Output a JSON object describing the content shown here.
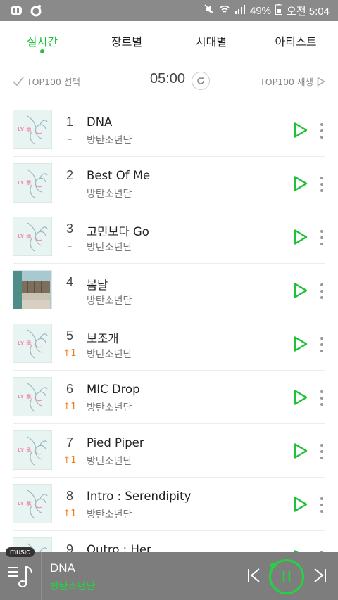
{
  "status_bar": {
    "battery": "49%",
    "time": "오전 5:04",
    "left_icons": [
      "launcher-icon",
      "q-icon"
    ],
    "right_icons": [
      "mute-icon",
      "wifi-icon",
      "signal-icon",
      "battery-icon"
    ]
  },
  "tabs": [
    {
      "label": "실시간",
      "active": true
    },
    {
      "label": "장르별",
      "active": false
    },
    {
      "label": "시대별",
      "active": false
    },
    {
      "label": "아티스트",
      "active": false
    }
  ],
  "controls": {
    "select_label": "TOP100 선택",
    "time": "05:00",
    "play_label": "TOP100 재생"
  },
  "songs": [
    {
      "rank": "1",
      "change": "–",
      "change_type": "same",
      "title": "DNA",
      "artist": "방탄소년단",
      "art": "lyh"
    },
    {
      "rank": "2",
      "change": "–",
      "change_type": "same",
      "title": "Best Of Me",
      "artist": "방탄소년단",
      "art": "lyh"
    },
    {
      "rank": "3",
      "change": "–",
      "change_type": "same",
      "title": "고민보다 Go",
      "artist": "방탄소년단",
      "art": "lyh"
    },
    {
      "rank": "4",
      "change": "–",
      "change_type": "same",
      "title": "봄날",
      "artist": "방탄소년단",
      "art": "yng"
    },
    {
      "rank": "5",
      "change": "↑1",
      "change_type": "up",
      "title": "보조개",
      "artist": "방탄소년단",
      "art": "lyh"
    },
    {
      "rank": "6",
      "change": "↑1",
      "change_type": "up",
      "title": "MIC Drop",
      "artist": "방탄소년단",
      "art": "lyh"
    },
    {
      "rank": "7",
      "change": "↑1",
      "change_type": "up",
      "title": "Pied Piper",
      "artist": "방탄소년단",
      "art": "lyh"
    },
    {
      "rank": "8",
      "change": "↑1",
      "change_type": "up",
      "title": "Intro : Serendipity",
      "artist": "방탄소년단",
      "art": "lyh"
    },
    {
      "rank": "9",
      "change": "",
      "change_type": "same",
      "title": "Outro : Her",
      "artist": "",
      "art": "lyh"
    }
  ],
  "player": {
    "tag": "music",
    "title": "DNA",
    "artist": "방탄소년단"
  },
  "colors": {
    "accent": "#1fc13a",
    "up": "#f07c1a",
    "status_bar": "#8a8a8a",
    "player_bg": "#7d7d7d"
  }
}
